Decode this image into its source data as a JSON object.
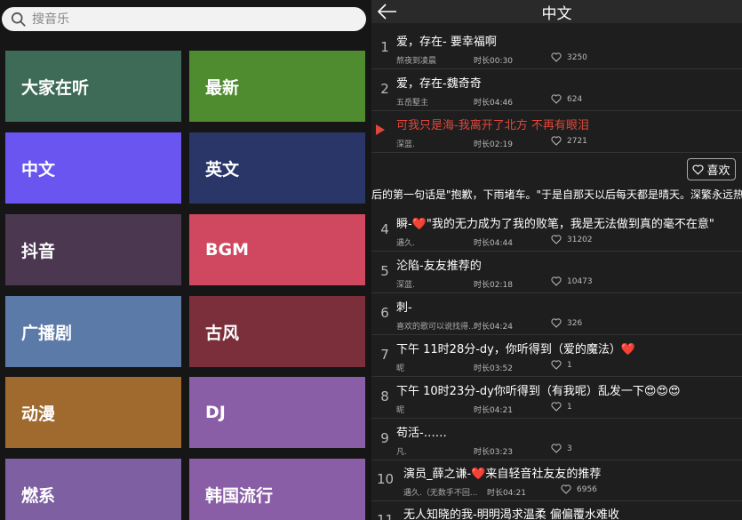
{
  "search": {
    "placeholder": "搜音乐"
  },
  "categories": [
    {
      "label": "大家在听",
      "color": "#3e6b58"
    },
    {
      "label": "最新",
      "color": "#4e8c2f"
    },
    {
      "label": "中文",
      "color": "#6a55f0"
    },
    {
      "label": "英文",
      "color": "#2a3668"
    },
    {
      "label": "抖音",
      "color": "#4b3850"
    },
    {
      "label": "BGM",
      "color": "#d04860"
    },
    {
      "label": "广播剧",
      "color": "#5b7aa8"
    },
    {
      "label": "古风",
      "color": "#7a2f3b"
    },
    {
      "label": "动漫",
      "color": "#a06a2e"
    },
    {
      "label": "DJ",
      "color": "#8a5ea6"
    },
    {
      "label": "燃系",
      "color": "#7e5fa2"
    },
    {
      "label": "韩国流行",
      "color": "#8a5ea6"
    }
  ],
  "header": {
    "title": "中文"
  },
  "like_button": {
    "label": "喜欢"
  },
  "ticker": {
    "text": "后的第一句话是\"抱歉，下雨堵车。\"于是自那天以后每天都是晴天。深繁永远热恋"
  },
  "songs": [
    {
      "num": "1",
      "title": "爱，存在-      要幸福啊",
      "artist": "熬夜到凌晨",
      "duration": "时长00:30",
      "likes": "3250"
    },
    {
      "num": "2",
      "title": "爱，存在-魏奇奇",
      "artist": "五岳墅主",
      "duration": "时长04:46",
      "likes": "624"
    },
    {
      "num": "",
      "title": "可我只是海-我离开了北方 不再有眼泪",
      "artist": "深蓝.",
      "duration": "时长02:19",
      "likes": "2721"
    },
    {
      "num": "4",
      "title": "瞬-❤️\"我的无力成为了我的败笔，我是无法做到真的毫不在意\"",
      "artist": "遇久.",
      "duration": "时长04:44",
      "likes": "31202"
    },
    {
      "num": "5",
      "title": "沦陷-友友推荐的",
      "artist": "深蓝.",
      "duration": "时长02:18",
      "likes": "10473"
    },
    {
      "num": "6",
      "title": "刺-",
      "artist": "喜欢的歌可以说找得...",
      "duration": "时长04:24",
      "likes": "326"
    },
    {
      "num": "7",
      "title": "下午 11时28分-dy，你听得到（爱的魔法）❤️",
      "artist": "昵",
      "duration": "时长03:52",
      "likes": "1"
    },
    {
      "num": "8",
      "title": "下午 10时23分-dy你听得到（有我呢）乱发一下😍😍😍",
      "artist": "昵",
      "duration": "时长04:21",
      "likes": "1"
    },
    {
      "num": "9",
      "title": "苟活-……",
      "artist": "凡.",
      "duration": "时长03:23",
      "likes": "3"
    },
    {
      "num": "10",
      "title": "演员_薛之谦-❤️来自轻音社友友的推荐",
      "artist": "遇久.（无数手不回...",
      "duration": "时长04:21",
      "likes": "6956"
    },
    {
      "num": "11",
      "title": "无人知晓的我-明明渴求温柔 偏偏覆水难收",
      "artist": "",
      "duration": "",
      "likes": ""
    }
  ]
}
